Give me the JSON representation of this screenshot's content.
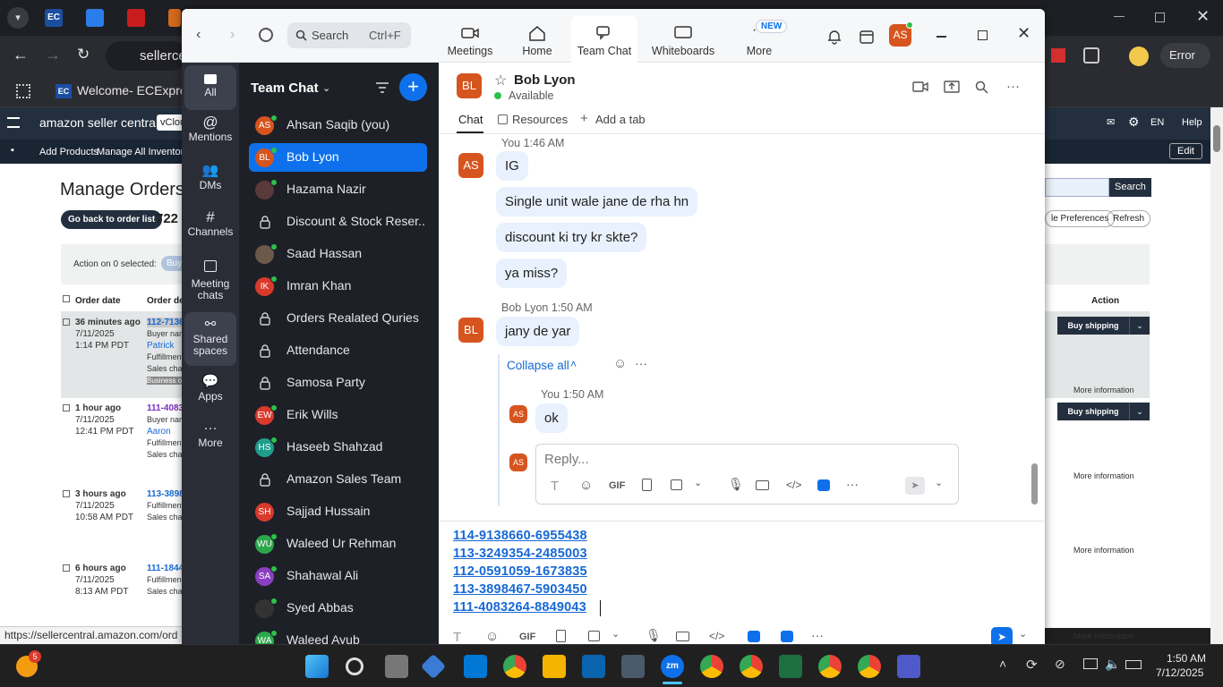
{
  "browser": {
    "tab_title": "Welcome- ECExpres...",
    "address_partial": "sellerce",
    "status_url": "https://sellercentral.amazon.com/ord",
    "error_label": "Error",
    "notification_count": "5"
  },
  "amazon": {
    "logo_text": "amazon seller central",
    "store_chip": "vClou",
    "nav_right": [
      "EN",
      "Help"
    ],
    "subnav": [
      "Add Products",
      "Manage All Inventory"
    ],
    "edit_button": "Edit",
    "page_title": "Manage Orders",
    "back_button": "Go back to order list",
    "order_count_partial": "722",
    "search_button": "Search",
    "preferences_button": "le Preferences",
    "refresh_button": "Refresh",
    "action_text": "Action on 0 selected:",
    "action_chip": "Buy",
    "col_order_date": "Order date",
    "col_order_details": "Order deta",
    "col_action": "Action",
    "buy_shipping": "Buy shipping",
    "more_info": "More information",
    "orders": [
      {
        "age": "36 minutes ago",
        "date": "7/11/2025",
        "time": "1:14 PM PDT",
        "id": "112-7136",
        "lines": [
          "Buyer nam",
          "Patrick",
          "Fulfillment",
          "Sales chan",
          "Business ord"
        ]
      },
      {
        "age": "1 hour ago",
        "date": "7/11/2025",
        "time": "12:41 PM PDT",
        "id": "111-4083",
        "lines": [
          "Buyer nam",
          "Aaron",
          "Fulfillment",
          "Sales chan"
        ]
      },
      {
        "age": "3 hours ago",
        "date": "7/11/2025",
        "time": "10:58 AM PDT",
        "id": "113-3898",
        "lines": [
          "Fulfillment",
          "Sales chan"
        ]
      },
      {
        "age": "6 hours ago",
        "date": "7/11/2025",
        "time": "8:13 AM PDT",
        "id": "111-1844",
        "lines": [
          "Fulfillment",
          "Sales chan"
        ]
      }
    ]
  },
  "zoom": {
    "search_placeholder": "Search",
    "search_shortcut": "Ctrl+F",
    "tabs": [
      {
        "label": "Meetings"
      },
      {
        "label": "Home"
      },
      {
        "label": "Team Chat"
      },
      {
        "label": "Whiteboards"
      },
      {
        "label": "More",
        "badge": "NEW"
      }
    ],
    "user_initials": "AS",
    "rail": [
      {
        "label": "All"
      },
      {
        "label": "Mentions"
      },
      {
        "label": "DMs"
      },
      {
        "label": "Channels"
      },
      {
        "label": "Meeting chats"
      },
      {
        "label": "Shared spaces"
      },
      {
        "label": "Apps"
      },
      {
        "label": "More"
      }
    ],
    "list_title": "Team Chat",
    "contacts": [
      {
        "name": "Ahsan Saqib (you)",
        "initials": "AS",
        "color": "#d6541e",
        "type": "avatar",
        "online": true
      },
      {
        "name": "Bob Lyon",
        "initials": "BL",
        "color": "#d6541e",
        "type": "avatar",
        "online": true,
        "selected": true
      },
      {
        "name": "Hazama Nazir",
        "initials": "",
        "color": "#5a3a3a",
        "type": "photo",
        "online": true
      },
      {
        "name": "Discount & Stock Reser...",
        "type": "lock"
      },
      {
        "name": "Saad Hassan",
        "initials": "",
        "color": "#6b5a4a",
        "type": "photo",
        "online": true
      },
      {
        "name": "Imran Khan",
        "initials": "IK",
        "color": "#d93a2b",
        "type": "avatar",
        "online": true
      },
      {
        "name": "Orders Realated Quries",
        "type": "lock"
      },
      {
        "name": "Attendance",
        "type": "lock"
      },
      {
        "name": "Samosa Party",
        "type": "lock"
      },
      {
        "name": "Erik Wills",
        "initials": "EW",
        "color": "#d93a2b",
        "type": "avatar",
        "online": true
      },
      {
        "name": "Haseeb Shahzad",
        "initials": "HS",
        "color": "#1f9e8e",
        "type": "avatar",
        "online": true
      },
      {
        "name": "Amazon Sales Team",
        "type": "lock"
      },
      {
        "name": "Sajjad Hussain",
        "initials": "SH",
        "color": "#d93a2b",
        "type": "avatar"
      },
      {
        "name": "Waleed Ur Rehman",
        "initials": "WU",
        "color": "#2ca84a",
        "type": "avatar",
        "online": true
      },
      {
        "name": "Shahawal Ali",
        "initials": "SA",
        "color": "#8a3fc0",
        "type": "avatar",
        "online": true
      },
      {
        "name": "Syed Abbas",
        "initials": "",
        "color": "#333",
        "type": "photo",
        "online": true
      },
      {
        "name": "Waleed Ayub",
        "initials": "WA",
        "color": "#2ca84a",
        "type": "avatar",
        "online": true
      }
    ],
    "chat": {
      "name": "Bob Lyon",
      "status": "Available",
      "initials": "BL",
      "tabs": [
        "Chat",
        "Resources",
        "Add a tab"
      ],
      "messages": [
        {
          "sender": "You",
          "time": "1:46 AM",
          "initials": "AS",
          "texts": [
            "IG",
            "Single unit wale jane de rha hn",
            "discount ki try kr skte?",
            "ya miss?"
          ]
        },
        {
          "sender": "Bob Lyon",
          "time": "1:50 AM",
          "initials": "BL",
          "texts": [
            "jany de yar"
          ]
        }
      ],
      "collapse": "Collapse all",
      "reply_sender": "You",
      "reply_time": "1:50 AM",
      "reply_text": "ok",
      "reply_placeholder": "Reply...",
      "gif": "GIF",
      "compose_lines": [
        "114-9138660-6955438",
        "113-3249354-2485003",
        "112-0591059-1673835",
        "113-3898467-5903450",
        "111-4083264-8849043"
      ]
    }
  },
  "taskbar": {
    "time": "1:50 AM",
    "date": "7/12/2025"
  }
}
